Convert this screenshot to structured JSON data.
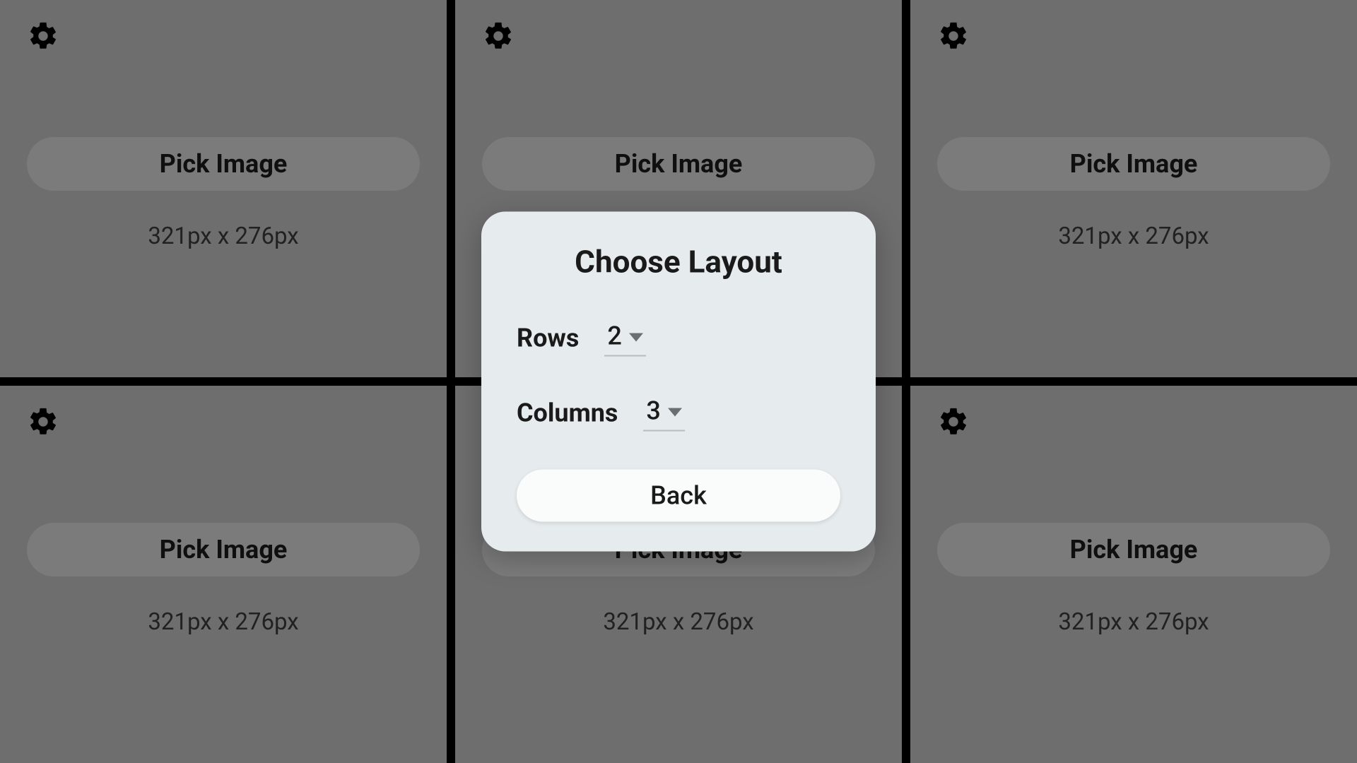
{
  "grid": {
    "rows": 2,
    "columns": 3,
    "cells": [
      {
        "pick_label": "Pick Image",
        "dimensions": "321px x 276px"
      },
      {
        "pick_label": "Pick Image",
        "dimensions": "321px x 276px"
      },
      {
        "pick_label": "Pick Image",
        "dimensions": "321px x 276px"
      },
      {
        "pick_label": "Pick Image",
        "dimensions": "321px x 276px"
      },
      {
        "pick_label": "Pick Image",
        "dimensions": "321px x 276px"
      },
      {
        "pick_label": "Pick Image",
        "dimensions": "321px x 276px"
      }
    ]
  },
  "dialog": {
    "title": "Choose Layout",
    "rows_label": "Rows",
    "rows_value": "2",
    "columns_label": "Columns",
    "columns_value": "3",
    "back_label": "Back"
  }
}
